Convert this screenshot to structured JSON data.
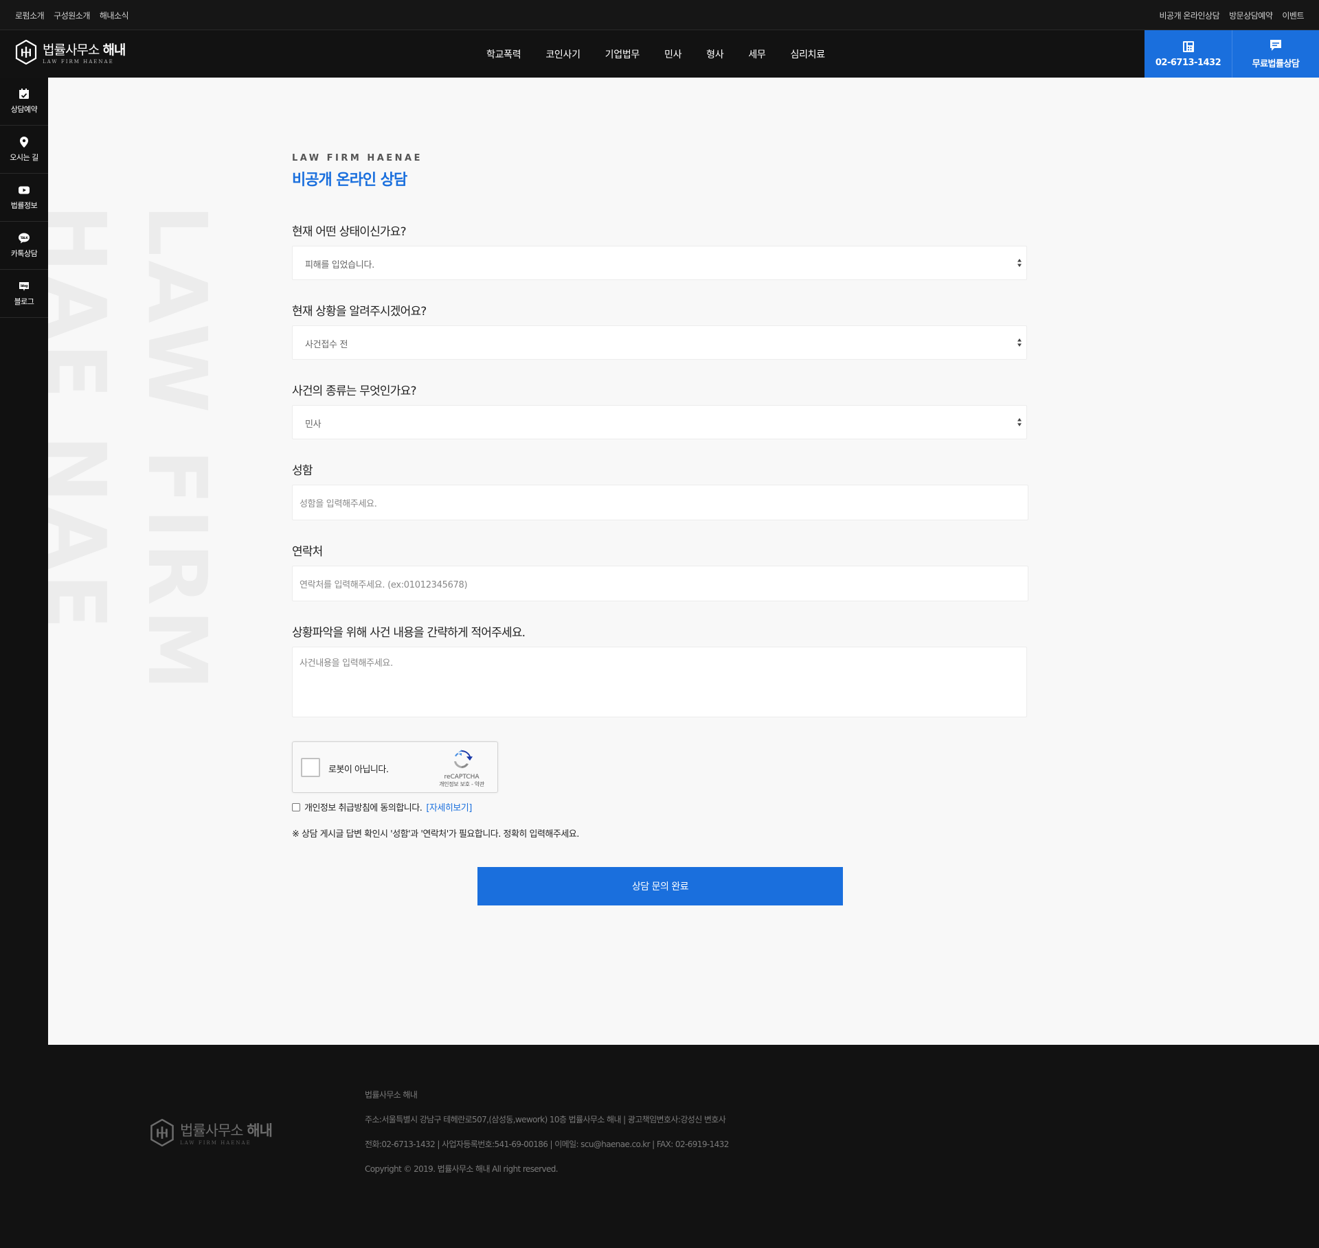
{
  "utilbar": {
    "left": [
      "로펌소개",
      "구성원소개",
      "해내소식"
    ],
    "right": [
      "비공개 온라인상담",
      "방문상담예약",
      "이벤트"
    ]
  },
  "header": {
    "logo_name": "법률사무소",
    "logo_name_bold": "해내",
    "logo_sub": "LAW FIRM HAENAE",
    "nav": [
      "학교폭력",
      "코인사기",
      "기업법무",
      "민사",
      "형사",
      "세무",
      "심리치료"
    ],
    "cta_phone": "02-6713-1432",
    "cta_consult": "무료법률상담"
  },
  "sidebar": [
    {
      "label": "상담예약",
      "icon": "calendar-check-icon"
    },
    {
      "label": "오시는 길",
      "icon": "map-pin-icon"
    },
    {
      "label": "법률정보",
      "icon": "youtube-icon"
    },
    {
      "label": "카톡상담",
      "icon": "kakao-talk-icon"
    },
    {
      "label": "블로그",
      "icon": "blog-icon"
    }
  ],
  "watermark": [
    "LAW FIRM",
    "HAE NAE"
  ],
  "form": {
    "eyebrow": "LAW FIRM HAENAE",
    "title": "비공개 온라인 상담",
    "q_status": "현재 어떤 상태이신가요?",
    "status_value": "피해를 입었습니다.",
    "q_situation": "현재 상황을 알려주시겠어요?",
    "situation_value": "사건접수 전",
    "q_type": "사건의 종류는 무엇인가요?",
    "type_value": "민사",
    "q_name": "성함",
    "name_placeholder": "성함을 입력해주세요.",
    "q_contact": "연락처",
    "contact_placeholder": "연락처를 입력해주세요. (ex:01012345678)",
    "q_detail": "상황파악을 위해 사건 내용을 간략하게 적어주세요.",
    "detail_placeholder": "사건내용을 입력해주세요.",
    "captcha_label": "로봇이 아닙니다.",
    "captcha_brand": "reCAPTCHA",
    "captcha_terms": "개인정보 보호 - 약관",
    "agree_text": "개인정보 취급방침에 동의합니다.",
    "agree_link": "[자세히보기]",
    "notice": "※ 상담 게시글 답변 확인시 '성함'과 '연락처'가 필요합니다. 정확히 입력해주세요.",
    "submit": "상담 문의 완료"
  },
  "footer": {
    "logo_name": "법률사무소",
    "logo_name_bold": "해내",
    "logo_sub": "LAW FIRM HAENAE",
    "lines": [
      "법률사무소 해내",
      "주소:서울특별시 강남구 테헤란로507,(삼성동,wework) 10층 법률사무소 해내 | 광고책임변호사:강성신 변호사",
      "전화:02-6713-1432 | 사업자등록번호:541-69-00186 | 이메일: scu@haenae.co.kr | FAX: 02-6919-1432",
      "Copyright © 2019. 법률사무소 해내 All right reserved."
    ]
  },
  "colors": {
    "accent": "#1a6fdd",
    "dark": "#121212",
    "panel": "#f8f8f8"
  }
}
